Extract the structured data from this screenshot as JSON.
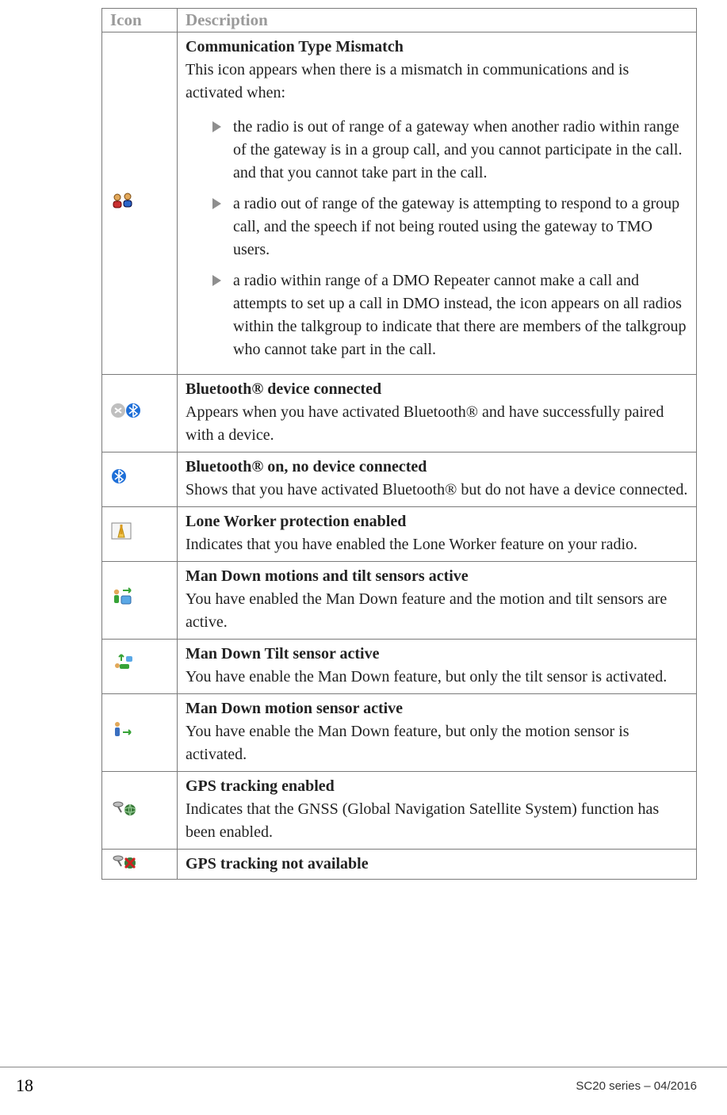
{
  "table": {
    "headers": {
      "icon": "Icon",
      "desc": "Description"
    },
    "rows": [
      {
        "icon_name": "communication-mismatch-icon",
        "title": "Communication Type Mismatch",
        "body": "This icon appears when there is a mismatch in communications and is activated when:",
        "bullets": [
          "the radio is out of range of a gateway when another radio within range of the gateway is in a group call, and you cannot participate in the call. and that you cannot take part in the call.",
          "a radio out of range of the gateway is attempting to respond to a group call, and the speech if not being routed using the gateway to TMO users.",
          "a radio within range of a DMO Repeater cannot make a call and attempts to set up a call in DMO instead, the icon appears on all radios within the talkgroup to indicate that there are members of the talkgroup who cannot take part in the call."
        ]
      },
      {
        "icon_name": "bluetooth-connected-icon",
        "title": "Bluetooth® device connected",
        "body": "Appears when you have activated Bluetooth® and have successfully paired with a device."
      },
      {
        "icon_name": "bluetooth-on-icon",
        "title": "Bluetooth® on, no device connected",
        "body": "Shows that you have activated Bluetooth® but do not have a device connected."
      },
      {
        "icon_name": "lone-worker-icon",
        "title": "Lone Worker protection enabled",
        "body": "Indicates that you have enabled the Lone Worker feature on your radio."
      },
      {
        "icon_name": "man-down-both-icon",
        "title": "Man Down motions and tilt sensors active",
        "body": "You have enabled the Man Down feature and the motion and tilt sensors are active."
      },
      {
        "icon_name": "man-down-tilt-icon",
        "title": "Man Down Tilt sensor active",
        "body": "You have enable the Man Down feature, but only the tilt sensor is activated."
      },
      {
        "icon_name": "man-down-motion-icon",
        "title": "Man Down motion sensor active",
        "body": "You have enable the Man Down feature, but only the motion sensor is activated."
      },
      {
        "icon_name": "gps-enabled-icon",
        "title": "GPS tracking enabled",
        "body": "Indicates that the GNSS (Global Navigation Satellite System) function has been enabled."
      },
      {
        "icon_name": "gps-unavailable-icon",
        "title": "GPS tracking not available",
        "body": ""
      }
    ]
  },
  "footer": {
    "page": "18",
    "product": "SC20 series – 04/2016"
  }
}
